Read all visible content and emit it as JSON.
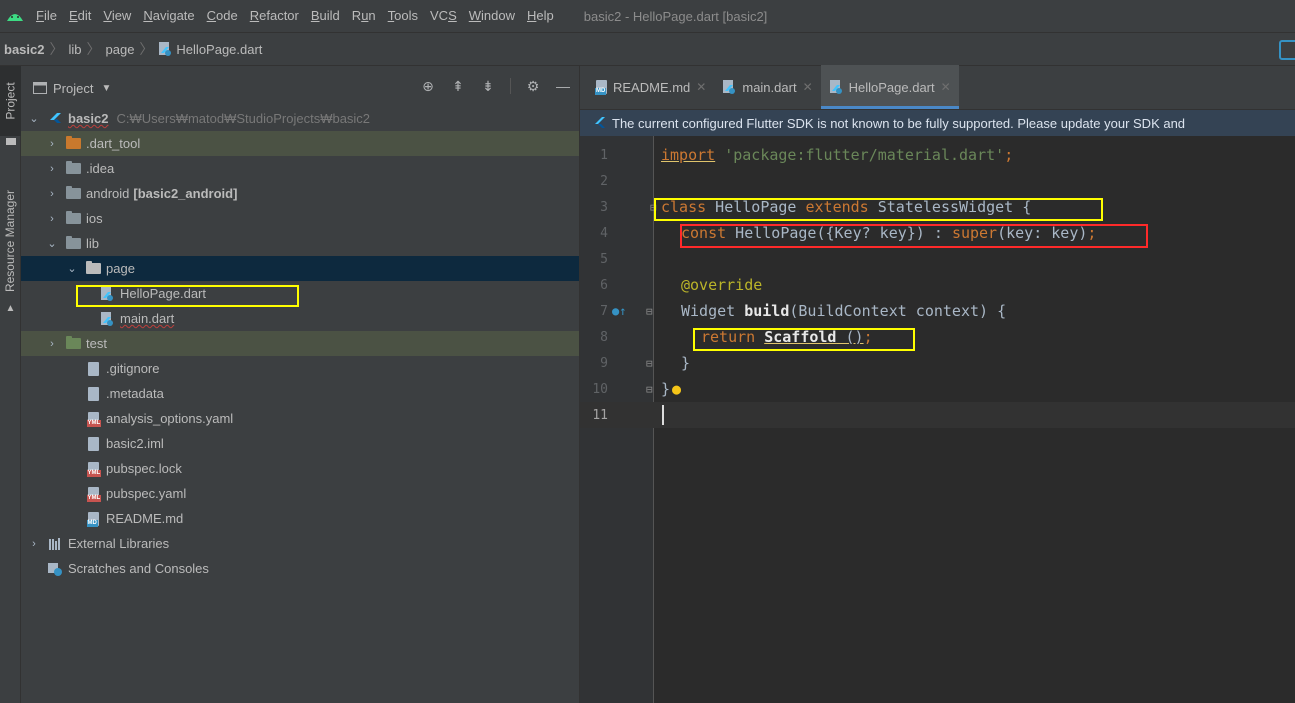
{
  "menubar": {
    "items": [
      {
        "pre": "",
        "mn": "F",
        "post": "ile"
      },
      {
        "pre": "",
        "mn": "E",
        "post": "dit"
      },
      {
        "pre": "",
        "mn": "V",
        "post": "iew"
      },
      {
        "pre": "",
        "mn": "N",
        "post": "avigate"
      },
      {
        "pre": "",
        "mn": "C",
        "post": "ode"
      },
      {
        "pre": "",
        "mn": "R",
        "post": "efactor"
      },
      {
        "pre": "",
        "mn": "B",
        "post": "uild"
      },
      {
        "pre": "R",
        "mn": "u",
        "post": "n"
      },
      {
        "pre": "",
        "mn": "T",
        "post": "ools"
      },
      {
        "pre": "VC",
        "mn": "S",
        "post": ""
      },
      {
        "pre": "",
        "mn": "W",
        "post": "indow"
      },
      {
        "pre": "",
        "mn": "H",
        "post": "elp"
      }
    ],
    "window_title": "basic2 - HelloPage.dart [basic2]"
  },
  "breadcrumb": {
    "root": "basic2",
    "lib": "lib",
    "page": "page",
    "file": "HelloPage.dart"
  },
  "toolstrip": {
    "project_tab": "Project",
    "resource_tab": "Resource Manager"
  },
  "project_panel": {
    "title": "Project",
    "tree": {
      "root_name": "basic2",
      "root_path": "C:₩Users₩matod₩StudioProjects₩basic2",
      "dart_tool": ".dart_tool",
      "idea": ".idea",
      "android": "android",
      "android_extra": "[basic2_android]",
      "ios": "ios",
      "lib": "lib",
      "page": "page",
      "hellopage": "HelloPage.dart",
      "main": "main.dart",
      "test": "test",
      "gitignore": ".gitignore",
      "metadata": ".metadata",
      "analysis": "analysis_options.yaml",
      "iml": "basic2.iml",
      "lock": "pubspec.lock",
      "pubspec": "pubspec.yaml",
      "readme": "README.md",
      "external": "External Libraries",
      "scratches": "Scratches and Consoles"
    }
  },
  "editor": {
    "tabs": [
      {
        "label": "README.md"
      },
      {
        "label": "main.dart"
      },
      {
        "label": "HelloPage.dart"
      }
    ],
    "notice": "The current configured Flutter SDK is not known to be fully supported. Please update your SDK and",
    "line_numbers": [
      "1",
      "2",
      "3",
      "4",
      "5",
      "6",
      "7",
      "8",
      "9",
      "10",
      "11"
    ],
    "code": {
      "l1_kw": "import",
      "l1_str": "'package:flutter/material.dart'",
      "l1_end": ";",
      "l3_class": "class",
      "l3_name": " HelloPage ",
      "l3_extends": "extends",
      "l3_rest": " StatelessWidget {",
      "l4_const": "const",
      "l4_name": " HelloPage",
      "l4_args": "({Key? key}) : ",
      "l4_super": "super",
      "l4_rest": "(key: key)",
      "l4_end": ";",
      "l6_anno": "@override",
      "l7_type": "Widget ",
      "l7_fn": "build",
      "l7_rest": "(BuildContext context) {",
      "l8_ret": "return",
      "l8_call": "Scaffold",
      "l8_paren": " ()",
      "l8_end": ";",
      "l9": "}",
      "l10": "}"
    }
  },
  "colors": {
    "annotation_yellow": "#ffff00",
    "annotation_red": "#ff2a2a",
    "selection": "#0d293e",
    "accent": "#4a88c7"
  }
}
